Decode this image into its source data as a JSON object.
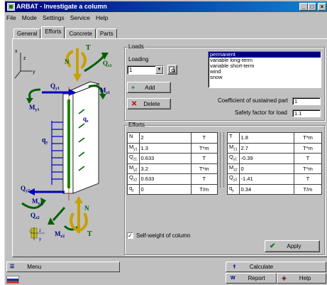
{
  "window": {
    "title": "ARBAT - Investigate a column"
  },
  "menu": [
    "File",
    "Mode",
    "Settings",
    "Service",
    "Help"
  ],
  "tabs": [
    "General",
    "Efforts",
    "Concrete",
    "Parts"
  ],
  "active_tab": "Efforts",
  "diagram": {
    "axes": {
      "z": "z",
      "y": "y",
      "x": "x"
    },
    "labels": {
      "T_top": "T",
      "N_top": "N",
      "Qz1": "Q",
      "Qz1_sub": "z1",
      "Mz1": "M",
      "Mz1_sub": "z1",
      "Qy1": "Q",
      "Qy1_sub": "y1",
      "My1": "M",
      "My1_sub": "y1",
      "qy": "q",
      "qy_sub": "y",
      "qz": "q",
      "qz_sub": "z",
      "Qy2": "Q",
      "Qy2_sub": "y2",
      "My2": "M",
      "My2_sub": "y2",
      "Qz2": "Q",
      "Qz2_sub": "z2",
      "Mz2": "M",
      "Mz2_sub": "z2",
      "N_bot": "N",
      "T_bot": "T",
      "z_sub": "z",
      "y_sub": "y"
    }
  },
  "loads": {
    "group_title": "Loads",
    "loading_label": "Loading",
    "loading_value": "1",
    "add_label": "Add",
    "delete_label": "Delete",
    "types": [
      "permanent",
      "variable long-term",
      "variable short-term",
      "wind",
      "snow"
    ],
    "selected_type": "permanent",
    "sustained_label": "Coefficient of sustained part",
    "sustained_value": "1",
    "safety_label": "Safety factor for load",
    "safety_value": "1.1"
  },
  "efforts": {
    "group_title": "Efforts",
    "left": [
      {
        "name": "N",
        "sub": "",
        "value": "2",
        "unit": "T"
      },
      {
        "name": "M",
        "sub": "y1",
        "value": "1.3",
        "unit": "T*m"
      },
      {
        "name": "Q",
        "sub": "z1",
        "value": "0.633",
        "unit": "T"
      },
      {
        "name": "M",
        "sub": "y2",
        "value": "3.2",
        "unit": "T*m"
      },
      {
        "name": "Q",
        "sub": "z2",
        "value": "0.633",
        "unit": "T"
      },
      {
        "name": "q",
        "sub": "z",
        "value": "0",
        "unit": "T/m"
      }
    ],
    "right": [
      {
        "name": "T",
        "sub": "",
        "value": "1.8",
        "unit": "T*m"
      },
      {
        "name": "M",
        "sub": "z1",
        "value": "2.7",
        "unit": "T*m"
      },
      {
        "name": "Q",
        "sub": "y1",
        "value": "-0.39",
        "unit": "T"
      },
      {
        "name": "M",
        "sub": "z2",
        "value": "0",
        "unit": "T*m"
      },
      {
        "name": "Q",
        "sub": "y2",
        "value": "-1.41",
        "unit": "T"
      },
      {
        "name": "q",
        "sub": "y",
        "value": "0.34",
        "unit": "T/m"
      }
    ]
  },
  "self_weight": {
    "label": "Self-weight of column",
    "checked": true
  },
  "apply_label": "Apply",
  "bottom": {
    "menu_label": "Menu",
    "calculate_label": "Calculate",
    "report_label": "Report",
    "help_label": "Help"
  },
  "colors": {
    "title_start": "#000080",
    "title_end": "#1084d0",
    "face": "#c0c0c0",
    "highlight": "#000080",
    "arrow_blue": "#0000c0",
    "arrow_green": "#006000",
    "column_green": "#00a000"
  }
}
